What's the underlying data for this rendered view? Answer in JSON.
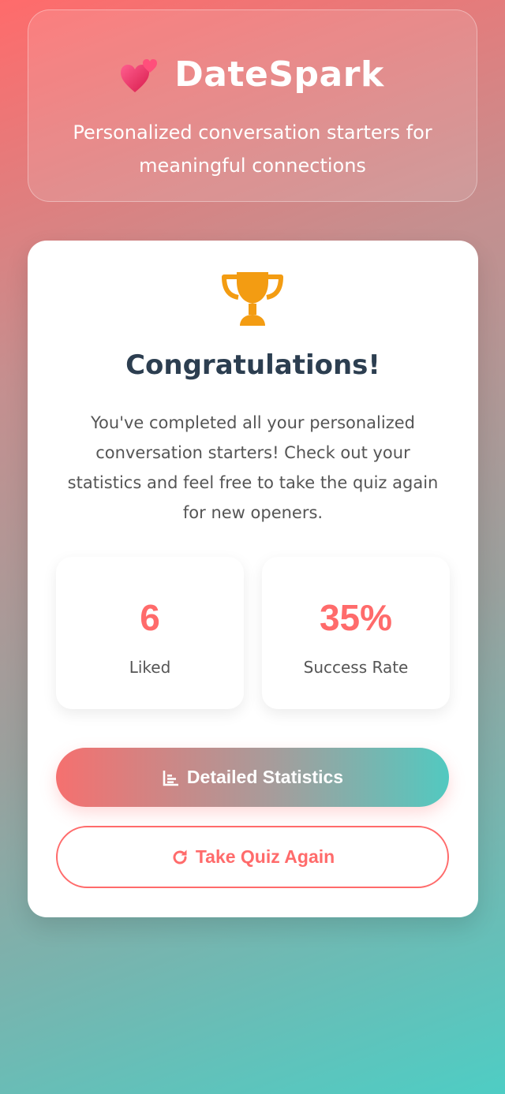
{
  "header": {
    "title": "DateSpark",
    "tagline": "Personalized conversation starters for meaningful connections",
    "logo_icon": "two-hearts-icon"
  },
  "results": {
    "trophy_icon": "trophy-icon",
    "title": "Congratulations!",
    "message": "You've completed all your personalized conversation starters! Check out your statistics and feel free to take the quiz again for new openers.",
    "stats": [
      {
        "value": "6",
        "label": "Liked"
      },
      {
        "value": "35%",
        "label": "Success Rate"
      }
    ]
  },
  "actions": {
    "details_label": "Detailed Statistics",
    "details_icon": "bar-chart-icon",
    "retake_label": "Take Quiz Again",
    "retake_icon": "redo-icon"
  },
  "colors": {
    "accent_coral": "#ff6b6b",
    "accent_teal": "#4ecdc4",
    "trophy_gold": "#f39c12",
    "heading_dark": "#2c3e50"
  }
}
